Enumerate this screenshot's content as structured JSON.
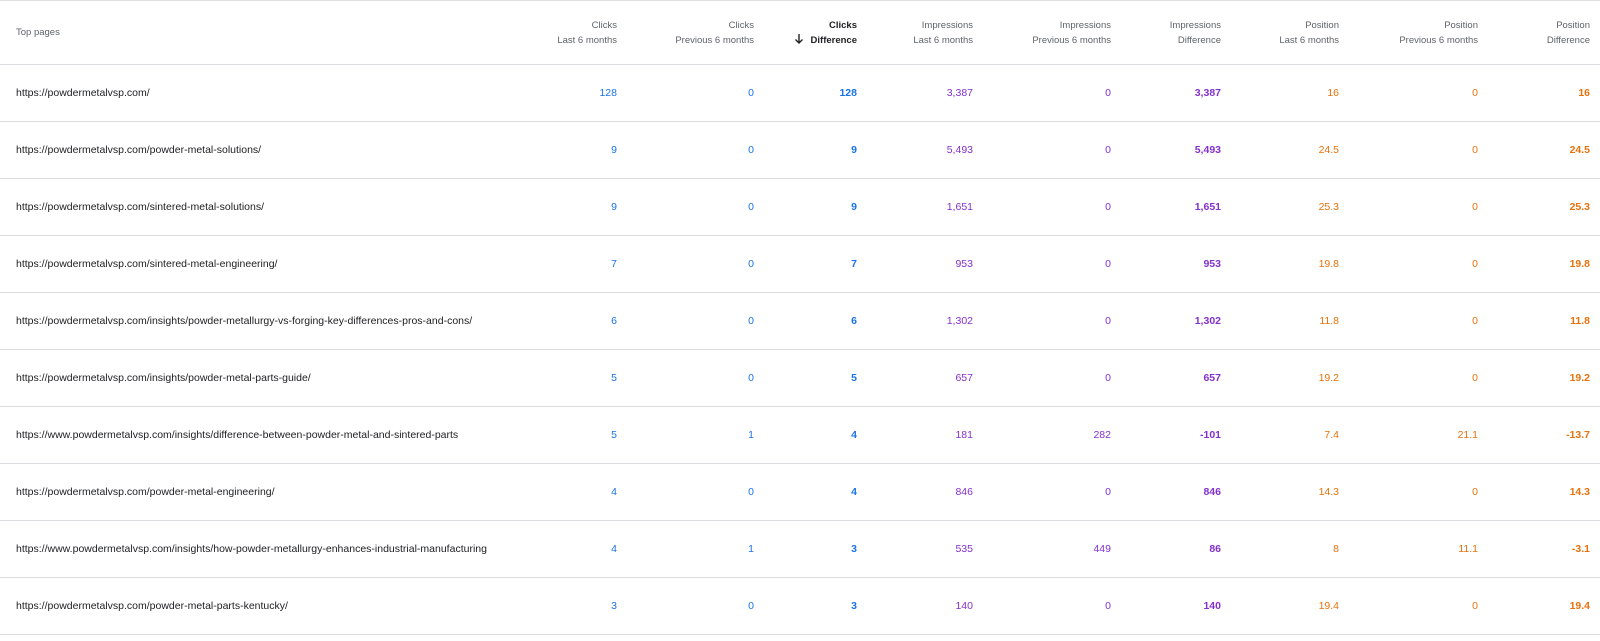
{
  "header": {
    "label": "Top pages",
    "columns": [
      {
        "line1": "Clicks",
        "line2": "Last 6 months"
      },
      {
        "line1": "Clicks",
        "line2": "Previous 6 months"
      },
      {
        "line1": "Clicks",
        "line2": "Difference"
      },
      {
        "line1": "Impressions",
        "line2": "Last 6 months"
      },
      {
        "line1": "Impressions",
        "line2": "Previous 6 months"
      },
      {
        "line1": "Impressions",
        "line2": "Difference"
      },
      {
        "line1": "Position",
        "line2": "Last 6 months"
      },
      {
        "line1": "Position",
        "line2": "Previous 6 months"
      },
      {
        "line1": "Position",
        "line2": "Difference"
      }
    ]
  },
  "colors": {
    "clicks": "#1a73e8",
    "impressions": "#8430ce",
    "position": "#e8710a"
  },
  "rows": [
    {
      "url": "https://powdermetalvsp.com/",
      "v": [
        "128",
        "0",
        "128",
        "3,387",
        "0",
        "3,387",
        "16",
        "0",
        "16"
      ]
    },
    {
      "url": "https://powdermetalvsp.com/powder-metal-solutions/",
      "v": [
        "9",
        "0",
        "9",
        "5,493",
        "0",
        "5,493",
        "24.5",
        "0",
        "24.5"
      ]
    },
    {
      "url": "https://powdermetalvsp.com/sintered-metal-solutions/",
      "v": [
        "9",
        "0",
        "9",
        "1,651",
        "0",
        "1,651",
        "25.3",
        "0",
        "25.3"
      ]
    },
    {
      "url": "https://powdermetalvsp.com/sintered-metal-engineering/",
      "v": [
        "7",
        "0",
        "7",
        "953",
        "0",
        "953",
        "19.8",
        "0",
        "19.8"
      ]
    },
    {
      "url": "https://powdermetalvsp.com/insights/powder-metallurgy-vs-forging-key-differences-pros-and-cons/",
      "v": [
        "6",
        "0",
        "6",
        "1,302",
        "0",
        "1,302",
        "11.8",
        "0",
        "11.8"
      ]
    },
    {
      "url": "https://powdermetalvsp.com/insights/powder-metal-parts-guide/",
      "v": [
        "5",
        "0",
        "5",
        "657",
        "0",
        "657",
        "19.2",
        "0",
        "19.2"
      ]
    },
    {
      "url": "https://www.powdermetalvsp.com/insights/difference-between-powder-metal-and-sintered-parts",
      "v": [
        "5",
        "1",
        "4",
        "181",
        "282",
        "-101",
        "7.4",
        "21.1",
        "-13.7"
      ]
    },
    {
      "url": "https://powdermetalvsp.com/powder-metal-engineering/",
      "v": [
        "4",
        "0",
        "4",
        "846",
        "0",
        "846",
        "14.3",
        "0",
        "14.3"
      ]
    },
    {
      "url": "https://www.powdermetalvsp.com/insights/how-powder-metallurgy-enhances-industrial-manufacturing",
      "v": [
        "4",
        "1",
        "3",
        "535",
        "449",
        "86",
        "8",
        "11.1",
        "-3.1"
      ]
    },
    {
      "url": "https://powdermetalvsp.com/powder-metal-parts-kentucky/",
      "v": [
        "3",
        "0",
        "3",
        "140",
        "0",
        "140",
        "19.4",
        "0",
        "19.4"
      ]
    }
  ]
}
